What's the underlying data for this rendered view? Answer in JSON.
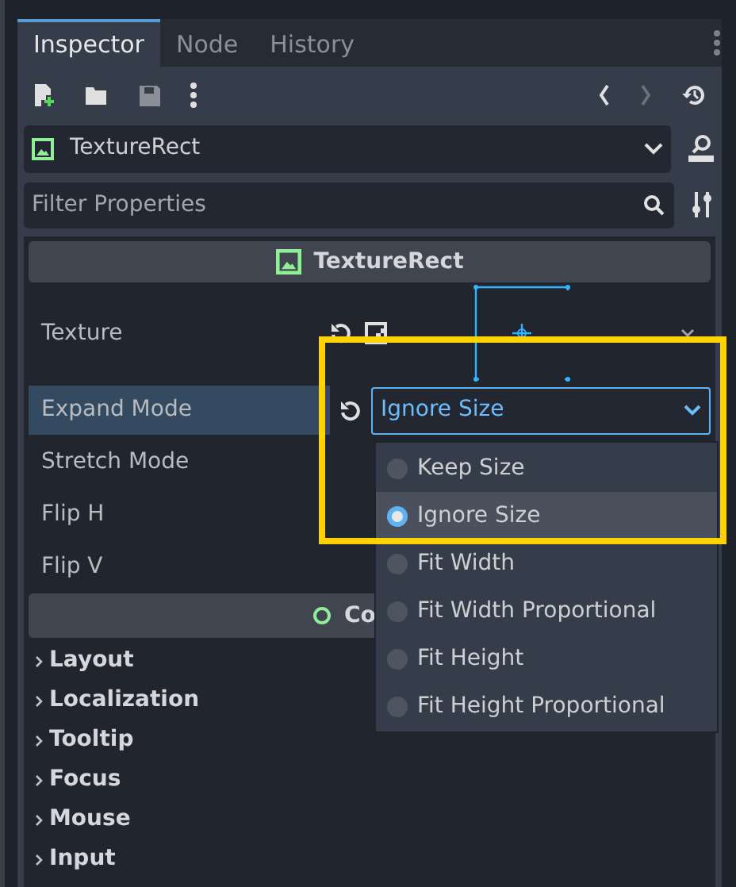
{
  "tabs": [
    {
      "label": "Inspector",
      "selected": true
    },
    {
      "label": "Node",
      "selected": false
    },
    {
      "label": "History",
      "selected": false
    }
  ],
  "toolbar": {
    "back_enabled": true,
    "forward_enabled": false
  },
  "object_selector": {
    "value": "TextureRect"
  },
  "filter": {
    "placeholder": "Filter Properties"
  },
  "section": {
    "title": "TextureRect"
  },
  "properties": [
    {
      "label": "Texture",
      "kind": "texture",
      "selected": false
    },
    {
      "label": "Expand Mode",
      "kind": "dropdown",
      "value": "Ignore Size",
      "selected": true
    },
    {
      "label": "Stretch Mode",
      "kind": "plain",
      "selected": false
    },
    {
      "label": "Flip H",
      "kind": "plain",
      "selected": false
    },
    {
      "label": "Flip V",
      "kind": "plain",
      "selected": false
    }
  ],
  "control_section": {
    "title": "Co"
  },
  "groups": [
    {
      "label": "Layout"
    },
    {
      "label": "Localization"
    },
    {
      "label": "Tooltip"
    },
    {
      "label": "Focus"
    },
    {
      "label": "Mouse"
    },
    {
      "label": "Input"
    }
  ],
  "popup": {
    "options": [
      {
        "label": "Keep Size",
        "selected": false
      },
      {
        "label": "Ignore Size",
        "selected": true
      },
      {
        "label": "Fit Width",
        "selected": false
      },
      {
        "label": "Fit Width Proportional",
        "selected": false
      },
      {
        "label": "Fit Height",
        "selected": false
      },
      {
        "label": "Fit Height Proportional",
        "selected": false
      }
    ]
  },
  "annotation": {
    "kind": "highlight-box",
    "color": "#ffd200"
  }
}
